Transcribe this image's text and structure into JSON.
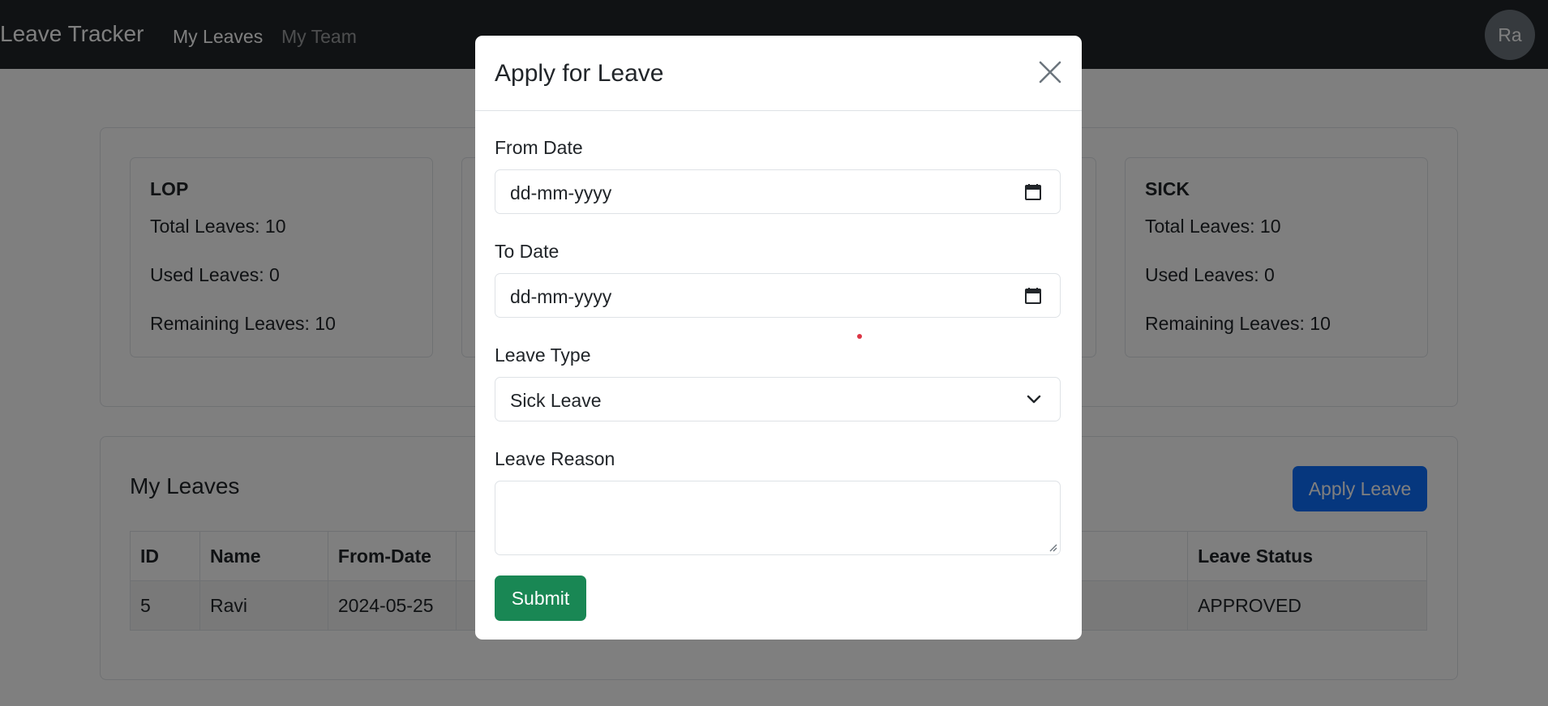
{
  "navbar": {
    "brand": "Leave Tracker",
    "links": [
      "My Leaves",
      "My Team"
    ],
    "avatar_initials": "Ra"
  },
  "leave_summary": [
    {
      "type": "LOP",
      "total": "Total Leaves: 10",
      "used": "Used Leaves: 0",
      "remaining": "Remaining Leaves: 10"
    },
    {
      "type": "SICK",
      "total": "Total Leaves: 10",
      "used": "Used Leaves: 0",
      "remaining": "Remaining Leaves: 10"
    }
  ],
  "my_leaves": {
    "title": "My Leaves",
    "apply_button": "Apply Leave",
    "columns": [
      "ID",
      "Name",
      "From-Date",
      "Leave Status"
    ],
    "rows": [
      {
        "id": "5",
        "name": "Ravi",
        "from_date": "2024-05-25",
        "status": "APPROVED"
      }
    ]
  },
  "modal": {
    "title": "Apply for Leave",
    "from_date_label": "From Date",
    "from_date_placeholder": "dd-mm-yyyy",
    "to_date_label": "To Date",
    "to_date_placeholder": "dd-mm-yyyy",
    "leave_type_label": "Leave Type",
    "leave_type_value": "Sick Leave",
    "leave_reason_label": "Leave Reason",
    "leave_reason_value": "",
    "submit_label": "Submit"
  },
  "colors": {
    "navbar": "#212529",
    "primary": "#0d6efd",
    "success": "#198754",
    "cursor": "#dc3545"
  },
  "icons": [
    "calendar-icon",
    "chevron-down-icon",
    "close-icon",
    "resize-grip-icon"
  ]
}
